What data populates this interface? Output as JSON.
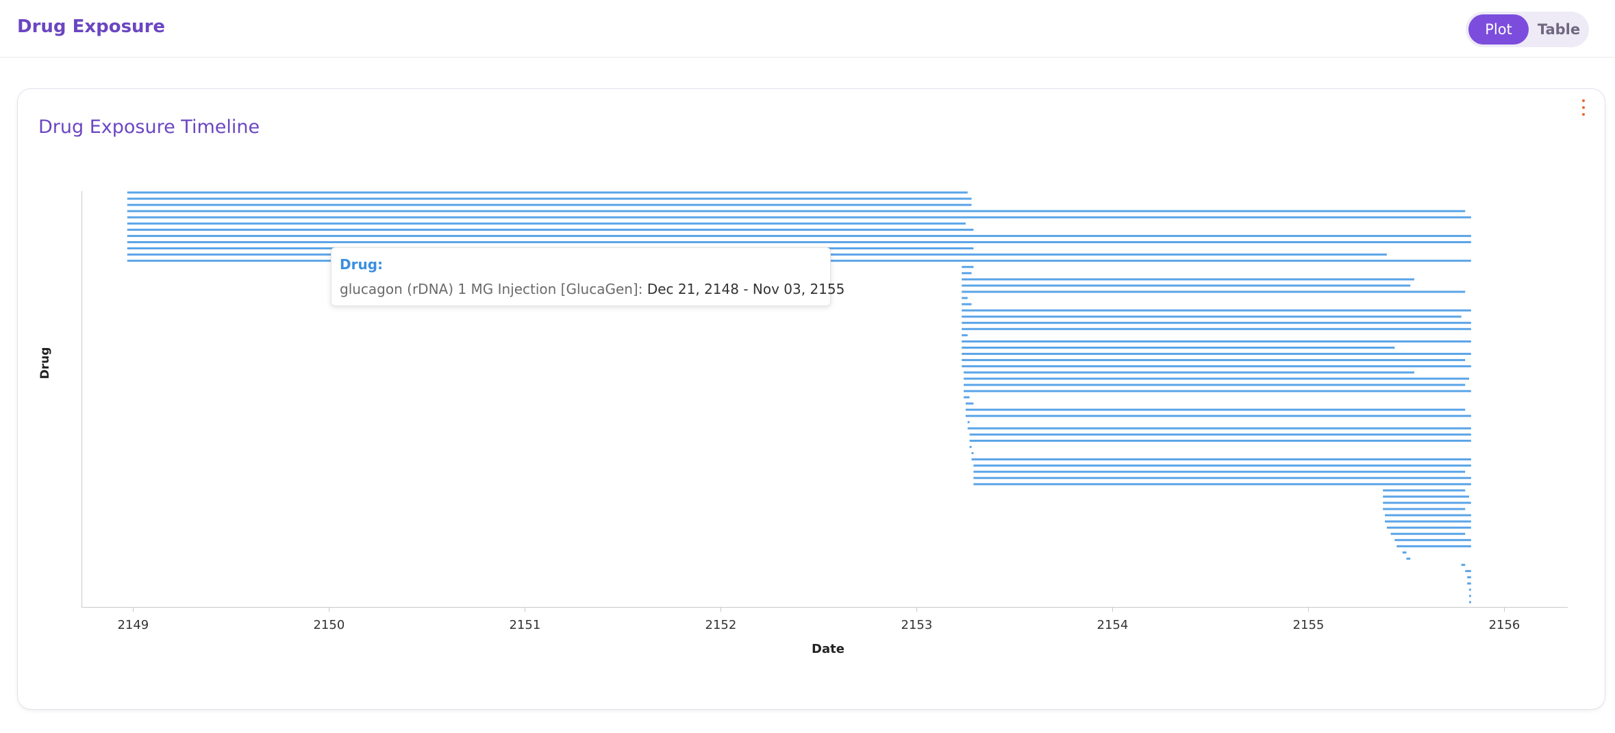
{
  "header": {
    "title": "Drug Exposure",
    "toggle": {
      "plot_label": "Plot",
      "table_label": "Table",
      "selected": "Plot"
    }
  },
  "card": {
    "title": "Drug Exposure Timeline",
    "menu_icon": "kebab-menu-icon"
  },
  "colors": {
    "bar": "#5aa4e8",
    "accent": "#6b46c1",
    "toggle_active": "#7c4ddd",
    "menu": "#e8692a"
  },
  "tooltip": {
    "label": "Drug:",
    "drug_name": "glucagon (rDNA) 1 MG Injection [GlucaGen]:",
    "date_range": "Dec 21, 2148 - Nov 03, 2155"
  },
  "chart_data": {
    "type": "timeline",
    "xlabel": "Date",
    "ylabel": "Drug",
    "x_ticks": [
      "2149",
      "2150",
      "2151",
      "2152",
      "2153",
      "2154",
      "2155",
      "2156"
    ],
    "xlim": [
      2148.74,
      2156.32
    ],
    "row_count": 67,
    "series": [
      {
        "values": [
          [
            2148.97,
            2153.26
          ],
          [
            2148.97,
            2153.28
          ],
          [
            2148.97,
            2153.28
          ],
          [
            2148.97,
            2155.8
          ],
          [
            2148.97,
            2155.83
          ],
          [
            2148.97,
            2153.25
          ],
          [
            2148.97,
            2153.29
          ],
          [
            2148.97,
            2155.83
          ],
          [
            2148.97,
            2155.83
          ],
          [
            2148.97,
            2153.29
          ],
          [
            2148.97,
            2155.4
          ],
          [
            2148.97,
            2155.83
          ],
          [
            2153.23,
            2153.29
          ],
          [
            2153.23,
            2153.28
          ],
          [
            2153.23,
            2155.54
          ],
          [
            2153.23,
            2155.52
          ],
          [
            2153.23,
            2155.8
          ],
          [
            2153.23,
            2153.26
          ],
          [
            2153.23,
            2153.28
          ],
          [
            2153.23,
            2155.83
          ],
          [
            2153.23,
            2155.78
          ],
          [
            2153.23,
            2155.83
          ],
          [
            2153.23,
            2155.83
          ],
          [
            2153.23,
            2153.26
          ],
          [
            2153.23,
            2155.83
          ],
          [
            2153.23,
            2155.44
          ],
          [
            2153.23,
            2155.83
          ],
          [
            2153.23,
            2155.8
          ],
          [
            2153.23,
            2155.83
          ],
          [
            2153.24,
            2155.54
          ],
          [
            2153.24,
            2155.82
          ],
          [
            2153.24,
            2155.8
          ],
          [
            2153.24,
            2155.83
          ],
          [
            2153.24,
            2153.27
          ],
          [
            2153.25,
            2153.29
          ],
          [
            2153.25,
            2155.8
          ],
          [
            2153.25,
            2155.83
          ],
          [
            2153.26,
            2153.27
          ],
          [
            2153.26,
            2155.83
          ],
          [
            2153.27,
            2155.83
          ],
          [
            2153.27,
            2155.83
          ],
          [
            2153.27,
            2153.28
          ],
          [
            2153.28,
            2153.29
          ],
          [
            2153.28,
            2155.83
          ],
          [
            2153.29,
            2155.83
          ],
          [
            2153.29,
            2155.8
          ],
          [
            2153.29,
            2155.83
          ],
          [
            2153.29,
            2155.83
          ],
          [
            2155.38,
            2155.8
          ],
          [
            2155.38,
            2155.82
          ],
          [
            2155.38,
            2155.83
          ],
          [
            2155.38,
            2155.8
          ],
          [
            2155.39,
            2155.83
          ],
          [
            2155.39,
            2155.83
          ],
          [
            2155.4,
            2155.83
          ],
          [
            2155.42,
            2155.8
          ],
          [
            2155.44,
            2155.83
          ],
          [
            2155.45,
            2155.83
          ],
          [
            2155.48,
            2155.5
          ],
          [
            2155.5,
            2155.52
          ],
          [
            2155.78,
            2155.8
          ],
          [
            2155.8,
            2155.83
          ],
          [
            2155.81,
            2155.83
          ],
          [
            2155.81,
            2155.83
          ],
          [
            2155.82,
            2155.83
          ],
          [
            2155.82,
            2155.83
          ],
          [
            2155.82,
            2155.83
          ]
        ]
      }
    ]
  }
}
